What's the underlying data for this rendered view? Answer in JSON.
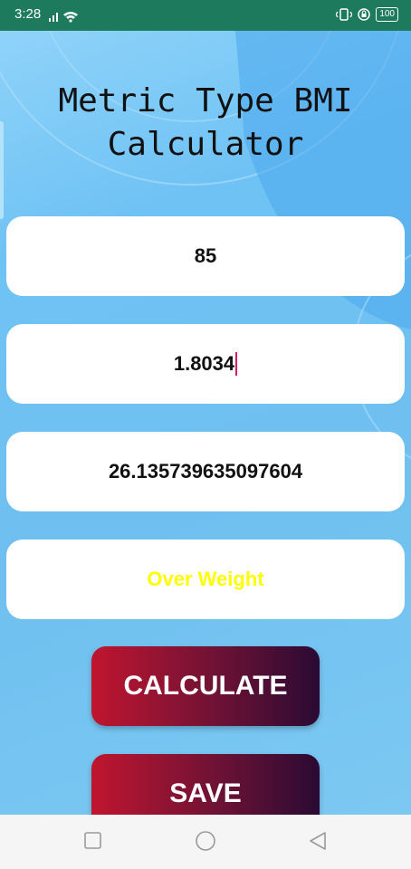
{
  "status_bar": {
    "time": "3:28",
    "battery": "100",
    "background": "#1d7a5c"
  },
  "app": {
    "title": "Metric Type BMI\nCalculator",
    "weight_value": "85",
    "height_value": "1.8034",
    "bmi_value": "26.135739635097604",
    "category_value": "Over Weight",
    "category_color": "#ffff00",
    "calculate_label": "CALCULATE",
    "save_label": "SAVE"
  },
  "nav": {
    "icons": [
      "recents-square-icon",
      "home-circle-icon",
      "back-triangle-icon"
    ]
  }
}
